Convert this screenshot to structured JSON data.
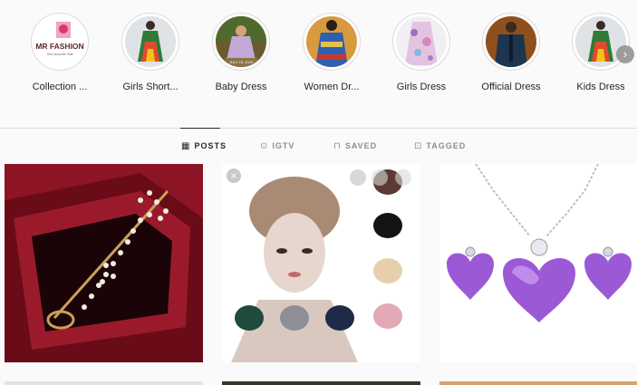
{
  "highlights": [
    {
      "label": "Collection ...",
      "logo_line1": "MR FASHION",
      "logo_line2": "Your favourite Side"
    },
    {
      "label": "Girls Short..."
    },
    {
      "label": "Baby Dress",
      "caption": "JULY 15, 2020"
    },
    {
      "label": "Women Dr..."
    },
    {
      "label": "Girls Dress"
    },
    {
      "label": "Official Dress"
    },
    {
      "label": "Kids Dress"
    }
  ],
  "highlights_next_glyph": "›",
  "tabs": [
    {
      "label": "POSTS",
      "icon": "grid-icon",
      "glyph": "▦",
      "active": true
    },
    {
      "label": "IGTV",
      "icon": "igtv-icon",
      "glyph": "⊙",
      "active": false
    },
    {
      "label": "SAVED",
      "icon": "bookmark-icon",
      "glyph": "⊓",
      "active": false
    },
    {
      "label": "TAGGED",
      "icon": "tagged-icon",
      "glyph": "⊡",
      "active": false
    }
  ],
  "posts": [
    {
      "subject": "brooch-pin"
    },
    {
      "subject": "turban-caps"
    },
    {
      "subject": "heart-necklace"
    }
  ]
}
